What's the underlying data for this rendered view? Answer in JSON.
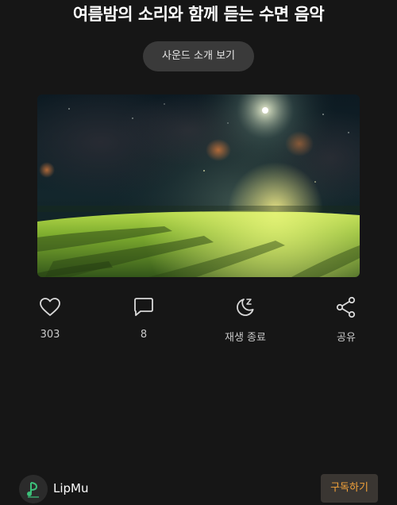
{
  "header": {
    "title": "여름밤의 소리와 함께 듣는 수면 음악"
  },
  "intro_button": {
    "label": "사운드 소개 보기"
  },
  "actions": [
    {
      "icon": "heart-icon",
      "label": "303"
    },
    {
      "icon": "comment-icon",
      "label": "8"
    },
    {
      "icon": "moon-sleep-icon",
      "label": "재생 종료"
    },
    {
      "icon": "share-icon",
      "label": "공유"
    }
  ],
  "channel": {
    "name": "LipMu",
    "subscribe_label": "구독하기"
  },
  "colors": {
    "background": "#161616",
    "accent": "#f2a23a",
    "button_bg": "#3a3a3a"
  }
}
